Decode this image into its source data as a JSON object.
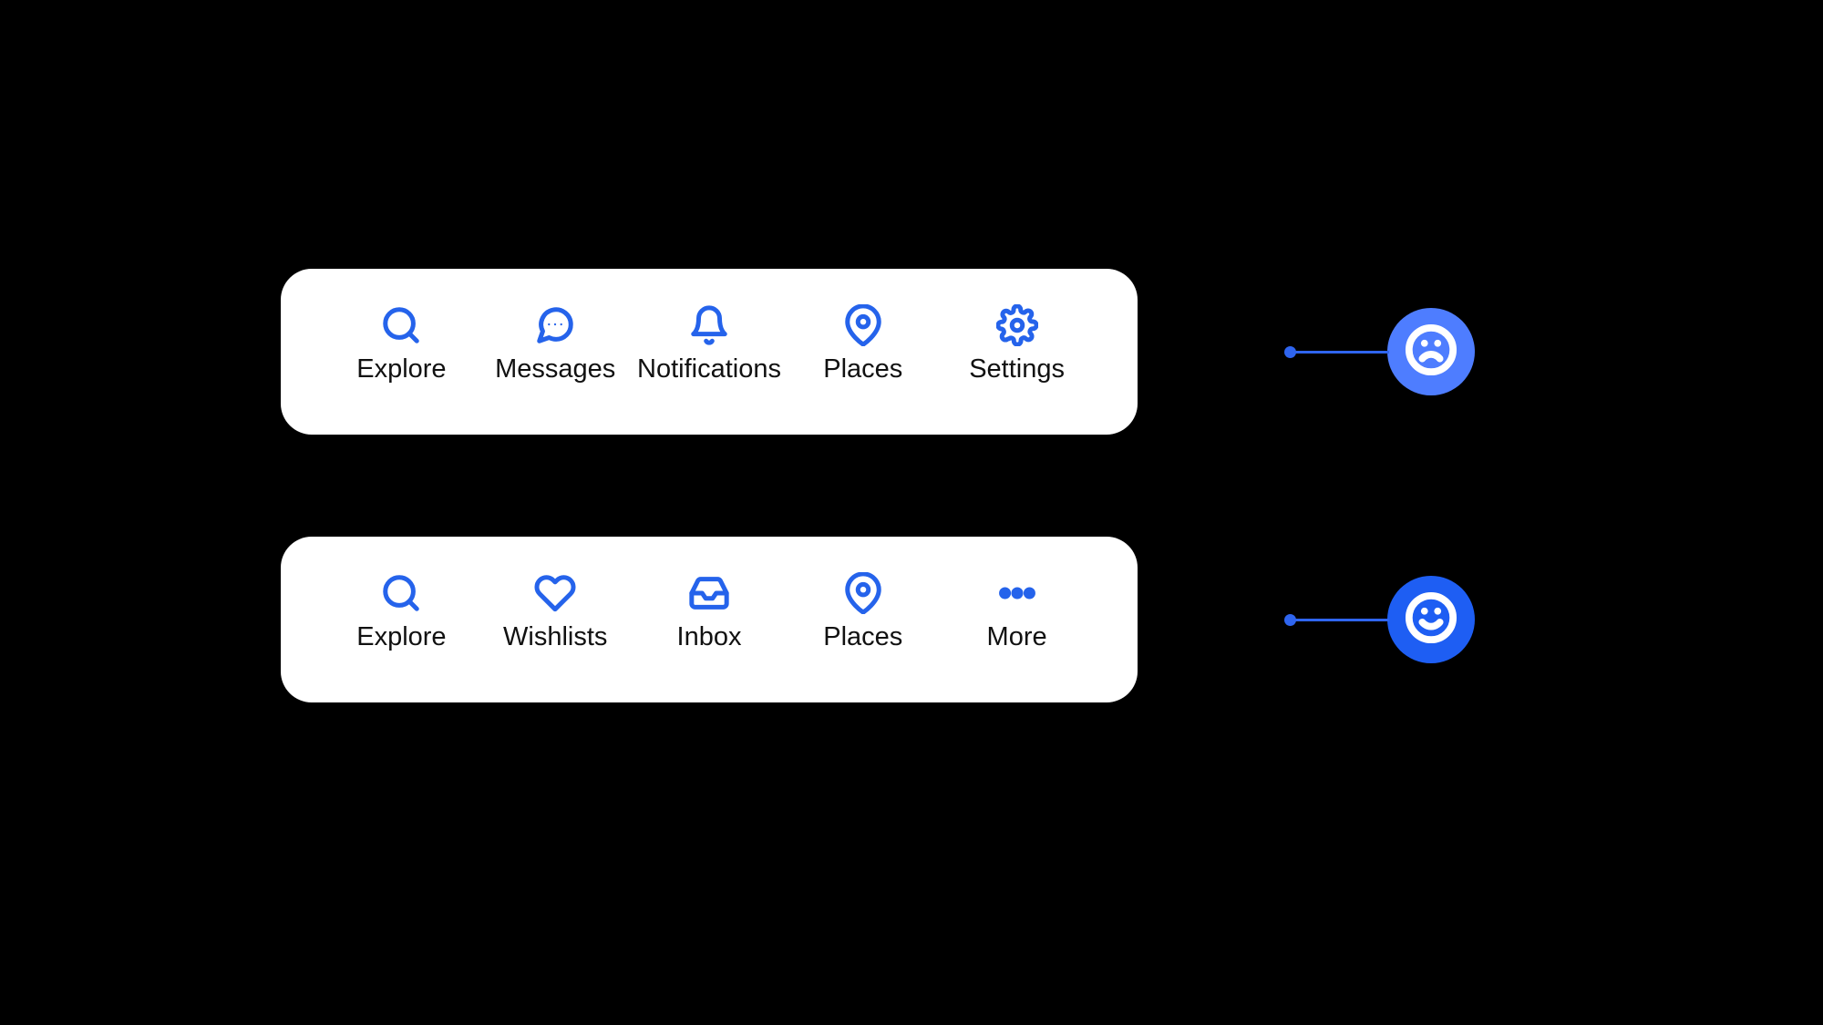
{
  "accent_color": "#2563eb",
  "tabbars": {
    "top": {
      "items": [
        {
          "label": "Explore",
          "icon": "search-icon"
        },
        {
          "label": "Messages",
          "icon": "chat-icon"
        },
        {
          "label": "Notifications",
          "icon": "bell-icon"
        },
        {
          "label": "Places",
          "icon": "pin-icon"
        },
        {
          "label": "Settings",
          "icon": "gear-icon"
        }
      ],
      "mood": "sad"
    },
    "bottom": {
      "items": [
        {
          "label": "Explore",
          "icon": "search-icon"
        },
        {
          "label": "Wishlists",
          "icon": "heart-icon"
        },
        {
          "label": "Inbox",
          "icon": "inbox-icon"
        },
        {
          "label": "Places",
          "icon": "pin-icon"
        },
        {
          "label": "More",
          "icon": "more-icon"
        }
      ],
      "mood": "happy"
    }
  }
}
